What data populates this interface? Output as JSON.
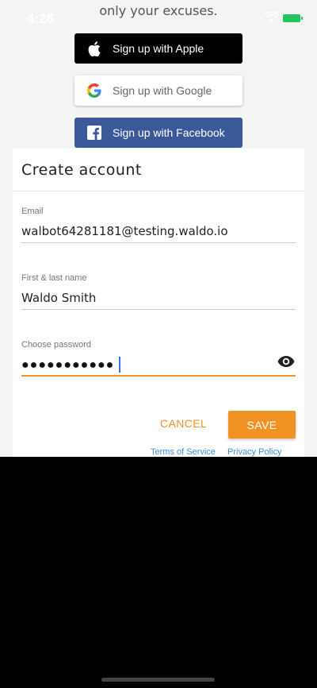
{
  "status_bar": {
    "time": "4:26"
  },
  "tagline": "only your excuses.",
  "social": {
    "apple": "Sign up with Apple",
    "google": "Sign up with Google",
    "facebook": "Sign up with Facebook"
  },
  "form": {
    "title": "Create account",
    "email": {
      "label": "Email",
      "value": "walbot64281181@testing.waldo.io"
    },
    "name": {
      "label": "First & last name",
      "value": "Waldo Smith"
    },
    "password": {
      "label": "Choose password",
      "masked_value": "●●●●●●●●●●●"
    },
    "cancel": "CANCEL",
    "save": "SAVE",
    "terms": "Terms of Service",
    "privacy": "Privacy Policy"
  },
  "colors": {
    "accent": "#f39224",
    "facebook": "#3b5998",
    "link": "#3d8fd6"
  }
}
